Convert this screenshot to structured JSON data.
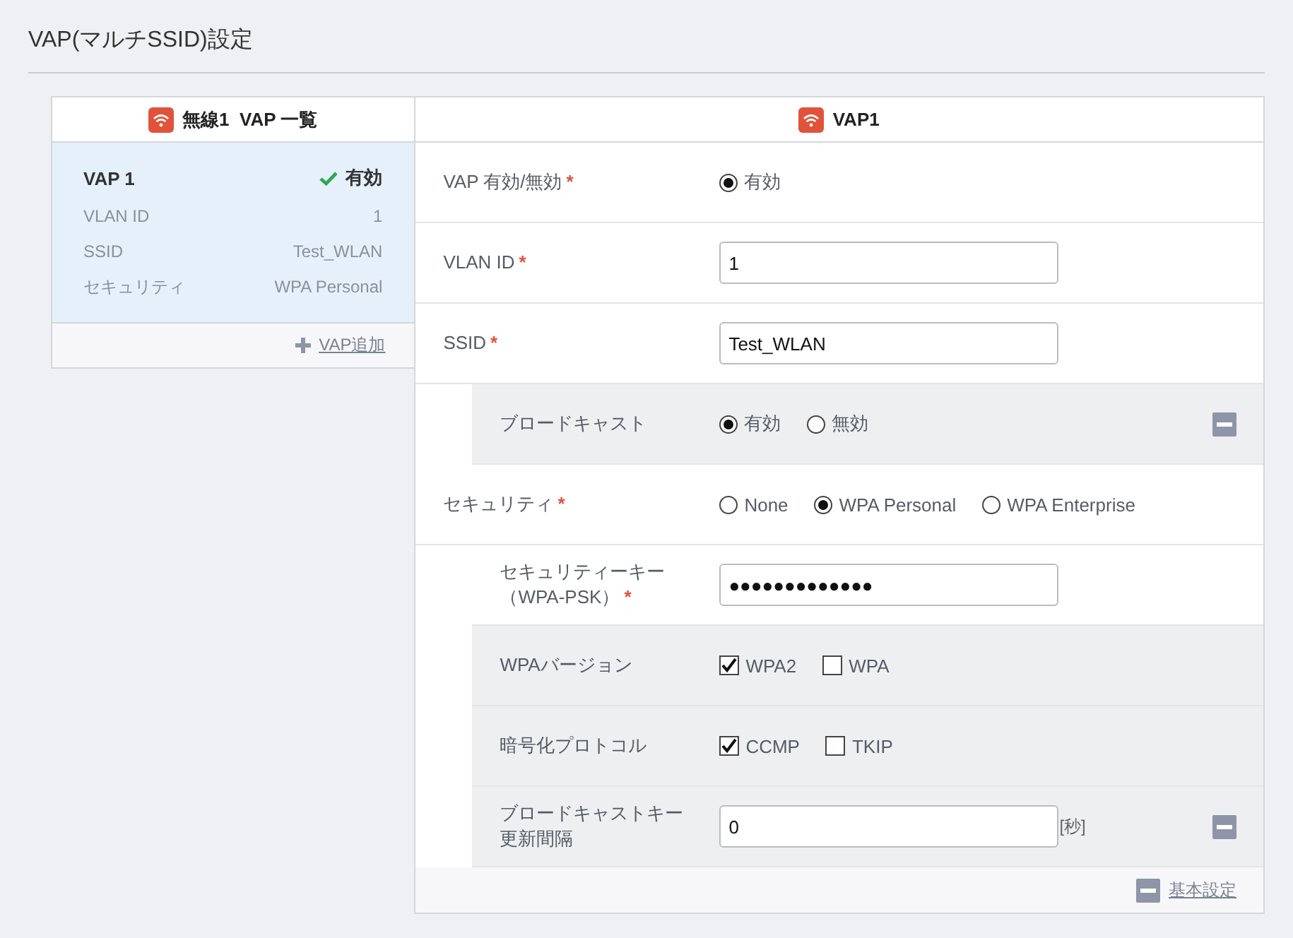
{
  "page_title": "VAP(マルチSSID)設定",
  "vap_list": {
    "title": "無線1  VAP 一覧",
    "items": [
      {
        "name": "VAP 1",
        "status": "有効",
        "enabled": true,
        "selected": true,
        "fields": [
          {
            "label": "VLAN ID",
            "value": "1"
          },
          {
            "label": "SSID",
            "value": "Test_WLAN"
          },
          {
            "label": "セキュリティ",
            "value": "WPA Personal"
          }
        ]
      }
    ],
    "add_link": "VAP追加"
  },
  "vap_detail": {
    "title": "VAP1",
    "rows": [
      {
        "kind": "radio",
        "label": [
          "VAP 有効/無効"
        ],
        "required": "*",
        "sub": false,
        "shaded": false,
        "options": [
          {
            "label": "有効",
            "selected": true
          }
        ]
      },
      {
        "kind": "text",
        "label": [
          "VLAN ID"
        ],
        "required": "*",
        "sub": false,
        "shaded": false,
        "value": "1"
      },
      {
        "kind": "text",
        "label": [
          "SSID"
        ],
        "required": "*",
        "sub": false,
        "shaded": false,
        "value": "Test_WLAN"
      },
      {
        "kind": "radio",
        "label": [
          "ブロードキャスト"
        ],
        "sub": true,
        "shaded": true,
        "collapse": true,
        "options": [
          {
            "label": "有効",
            "selected": true
          },
          {
            "label": "無効",
            "selected": false
          }
        ]
      },
      {
        "kind": "radio",
        "label": [
          "セキュリティ"
        ],
        "required": "*",
        "sub": false,
        "shaded": false,
        "options": [
          {
            "label": "None",
            "selected": false
          },
          {
            "label": "WPA Personal",
            "selected": true
          },
          {
            "label": "WPA Enterprise",
            "selected": false
          }
        ]
      },
      {
        "kind": "text",
        "label": [
          "セキュリティーキー",
          "（WPA-PSK）"
        ],
        "required": "*",
        "sub": true,
        "shaded": false,
        "value": "●●●●●●●●●●●●●"
      },
      {
        "kind": "checkbox",
        "label": [
          "WPAバージョン"
        ],
        "sub": true,
        "shaded": true,
        "options": [
          {
            "label": "WPA2",
            "checked": true
          },
          {
            "label": "WPA",
            "checked": false
          }
        ]
      },
      {
        "kind": "checkbox",
        "label": [
          "暗号化プロトコル"
        ],
        "sub": true,
        "shaded": true,
        "options": [
          {
            "label": "CCMP",
            "checked": true
          },
          {
            "label": "TKIP",
            "checked": false
          }
        ]
      },
      {
        "kind": "text",
        "label": [
          "ブロードキャストキー",
          "更新間隔"
        ],
        "sub": true,
        "shaded": true,
        "collapse": true,
        "value": "0",
        "suffix": "[秒]"
      }
    ],
    "footer_link": "基本設定"
  }
}
